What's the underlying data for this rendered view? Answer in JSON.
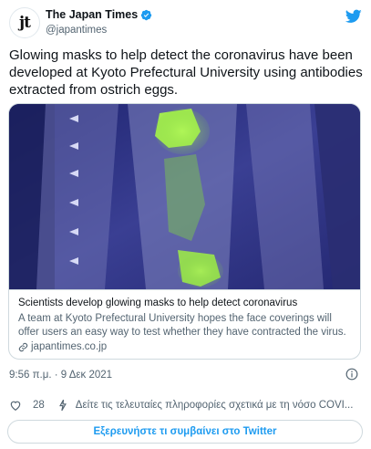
{
  "account": {
    "logo_text": "jt",
    "display_name": "The Japan Times",
    "handle": "@japantimes"
  },
  "tweet": {
    "text": "Glowing masks to help detect the coronavirus have been developed at Kyoto Prefectural University using antibodies extracted from ostrich eggs."
  },
  "card": {
    "title": "Scientists develop glowing masks to help detect coronavirus",
    "description": "A team at Kyoto Prefectural University hopes the face coverings will offer users an easy way to test whether they have contracted the virus.",
    "domain": "japantimes.co.jp",
    "image_icon": "glowing-mask-photo"
  },
  "meta": {
    "timestamp": "9:56 π.μ. · 9 Δεκ 2021"
  },
  "actions": {
    "like_count": "28",
    "covid_info": "Δείτε τις τελευταίες πληροφορίες σχετικά με τη νόσο COVI..."
  },
  "explore_button": "Εξερευνήστε τι συμβαίνει στο Twitter",
  "colors": {
    "twitter_blue": "#1d9bf0",
    "text_primary": "#0f1419",
    "text_secondary": "#536471",
    "border": "#cfd9de",
    "glow_green": "#9be84a"
  }
}
